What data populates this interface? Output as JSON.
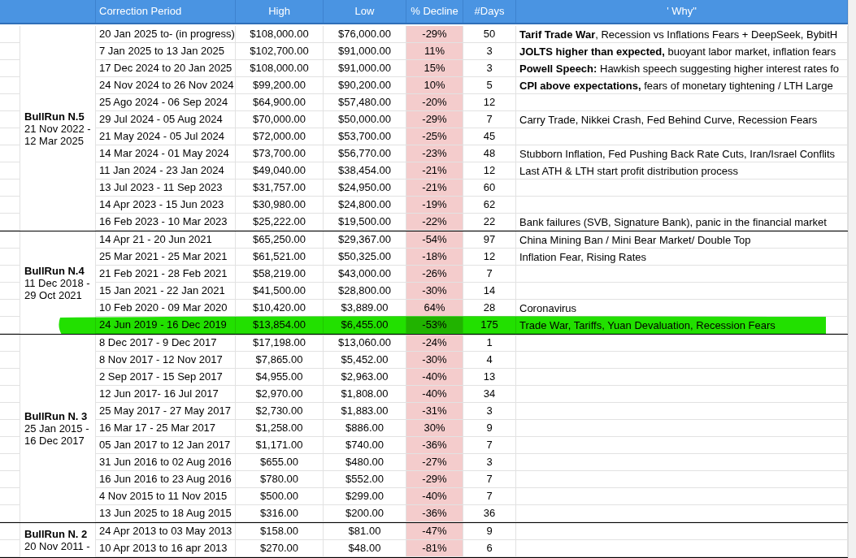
{
  "columns": [
    "Correction Period",
    "High",
    "Low",
    "% Decline",
    "#Days",
    "' Why\""
  ],
  "groups": [
    {
      "name": "BullRun N.5",
      "dates": [
        "21 Nov 2022 -",
        "12 Mar 2025"
      ],
      "rows": [
        {
          "period": "20 Jan 2025 to- (in progress)",
          "high": "$108,000.00",
          "low": "$76,000.00",
          "decline": "-29%",
          "days": "50",
          "why": "**Tarif Trade War**, Recession vs Inflations Fears + DeepSeek, BybitH",
          "highlighted": false
        },
        {
          "period": "7 Jan 2025 to 13 Jan 2025",
          "high": "$102,700.00",
          "low": "$91,000.00",
          "decline": "11%",
          "days": "3",
          "why": "**JOLTS higher than expected,** buoyant labor market, inflation fears",
          "highlighted": false
        },
        {
          "period": "17 Dec 2024 to 20 Jan 2025",
          "high": "$108,000.00",
          "low": "$91,000.00",
          "decline": "15%",
          "days": "3",
          "why": "**Powell Speech:** Hawkish speech suggesting higher interest rates fo",
          "highlighted": false
        },
        {
          "period": "24 Nov 2024 to 26 Nov 2024",
          "high": "$99,200.00",
          "low": "$90,200.00",
          "decline": "10%",
          "days": "5",
          "why": "**CPI above expectations,** fears of monetary tightening / LTH Large",
          "highlighted": false
        },
        {
          "period": "25 Ago 2024 - 06 Sep 2024",
          "high": "$64,900.00",
          "low": "$57,480.00",
          "decline": "-20%",
          "days": "12",
          "highlighted": false
        },
        {
          "period": "29 Jul 2024 - 05 Aug 2024",
          "high": "$70,000.00",
          "low": "$50,000.00",
          "decline": "-29%",
          "days": "7",
          "why": "Carry Trade, Nikkei Crash, Fed Behind Curve, Recession Fears",
          "highlighted": false
        },
        {
          "period": "21 May 2024 - 05 Jul 2024",
          "high": "$72,000.00",
          "low": "$53,700.00",
          "decline": "-25%",
          "days": "45",
          "highlighted": false
        },
        {
          "period": "14 Mar 2024 - 01 May 2024",
          "high": "$73,700.00",
          "low": "$56,770.00",
          "decline": "-23%",
          "days": "48",
          "why": "Stubborn Inflation, Fed Pushing Back Rate Cuts, Iran/Israel Conflits",
          "highlighted": false
        },
        {
          "period": "11 Jan 2024 - 23 Jan 2024",
          "high": "$49,040.00",
          "low": "$38,454.00",
          "decline": "-21%",
          "days": "12",
          "why": "Last ATH & LTH start profit distribution process",
          "highlighted": false
        },
        {
          "period": "13 Jul 2023 - 11 Sep 2023",
          "high": "$31,757.00",
          "low": "$24,950.00",
          "decline": "-21%",
          "days": "60",
          "highlighted": false
        },
        {
          "period": "14 Apr 2023 - 15 Jun 2023",
          "high": "$30,980.00",
          "low": "$24,800.00",
          "decline": "-19%",
          "days": "62",
          "highlighted": false
        },
        {
          "period": "16 Feb 2023 - 10 Mar 2023",
          "high": "$25,222.00",
          "low": "$19,500.00",
          "decline": "-22%",
          "days": "22",
          "why": "Bank failures (SVB, Signature Bank), panic in the financial market",
          "highlighted": false
        }
      ]
    },
    {
      "name": "BullRun N.4",
      "dates": [
        "11 Dec 2018 -",
        "29 Oct 2021"
      ],
      "rows": [
        {
          "period": "14 Apr 21 - 20 Jun 2021",
          "high": "$65,250.00",
          "low": "$29,367.00",
          "decline": "-54%",
          "days": "97",
          "why": "China Mining Ban / Mini Bear Market/ Double Top",
          "highlighted": false
        },
        {
          "period": "25 Mar 2021 - 25 Mar 2021",
          "high": "$61,521.00",
          "low": "$50,325.00",
          "decline": "-18%",
          "days": "12",
          "why": "Inflation Fear, Rising Rates",
          "highlighted": false
        },
        {
          "period": "21 Feb 2021 - 28 Feb 2021",
          "high": "$58,219.00",
          "low": "$43,000.00",
          "decline": "-26%",
          "days": "7",
          "highlighted": false
        },
        {
          "period": "15 Jan 2021 - 22 Jan 2021",
          "high": "$41,500.00",
          "low": "$28,800.00",
          "decline": "-30%",
          "days": "14",
          "highlighted": false
        },
        {
          "period": "10 Feb 2020 - 09 Mar 2020",
          "high": "$10,420.00",
          "low": "$3,889.00",
          "decline": "64%",
          "days": "28",
          "why": "Coronavirus",
          "highlighted": false
        },
        {
          "period": "24 Jun 2019 - 16 Dec 2019",
          "high": "$13,854.00",
          "low": "$6,455.00",
          "decline": "-53%",
          "days": "175",
          "why": "Trade War, Tariffs, Yuan Devaluation, Recession Fears",
          "highlighted": true
        }
      ]
    },
    {
      "name": "BullRun N. 3",
      "dates": [
        "25 Jan 2015 -",
        "16 Dec 2017"
      ],
      "rows": [
        {
          "period": "8 Dec 2017 - 9 Dec 2017",
          "high": "$17,198.00",
          "low": "$13,060.00",
          "decline": "-24%",
          "days": "1",
          "highlighted": false
        },
        {
          "period": "8 Nov 2017 - 12 Nov 2017",
          "high": "$7,865.00",
          "low": "$5,452.00",
          "decline": "-30%",
          "days": "4",
          "highlighted": false
        },
        {
          "period": "2 Sep 2017 - 15 Sep 2017",
          "high": "$4,955.00",
          "low": "$2,963.00",
          "decline": "-40%",
          "days": "13",
          "highlighted": false
        },
        {
          "period": "12 Jun 2017- 16 Jul 2017",
          "high": "$2,970.00",
          "low": "$1,808.00",
          "decline": "-40%",
          "days": "34",
          "highlighted": false
        },
        {
          "period": "25 May 2017 - 27 May 2017",
          "high": "$2,730.00",
          "low": "$1,883.00",
          "decline": "-31%",
          "days": "3",
          "highlighted": false
        },
        {
          "period": "16 Mar 17 - 25 Mar 2017",
          "high": "$1,258.00",
          "low": "$886.00",
          "decline": "30%",
          "days": "9",
          "highlighted": false
        },
        {
          "period": "05 Jan 2017 to 12 Jan 2017",
          "high": "$1,171.00",
          "low": "$740.00",
          "decline": "-36%",
          "days": "7",
          "highlighted": false
        },
        {
          "period": "31 Jun 2016 to 02 Aug 2016",
          "high": "$655.00",
          "low": "$480.00",
          "decline": "-27%",
          "days": "3",
          "highlighted": false
        },
        {
          "period": "16 Jun 2016 to 23 Aug 2016",
          "high": "$780.00",
          "low": "$552.00",
          "decline": "-29%",
          "days": "7",
          "highlighted": false
        },
        {
          "period": "4 Nov 2015 to 11 Nov 2015",
          "high": "$500.00",
          "low": "$299.00",
          "decline": "-40%",
          "days": "7",
          "highlighted": false
        },
        {
          "period": "13 Jun 2025 to 18 Aug 2015",
          "high": "$316.00",
          "low": "$200.00",
          "decline": "-36%",
          "days": "36",
          "highlighted": false
        }
      ]
    },
    {
      "name": "BullRun N. 2",
      "dates": [
        "20 Nov 2011 -"
      ],
      "rows": [
        {
          "period": "24 Apr 2013 to 03 May 2013",
          "high": "$158.00",
          "low": "$81.00",
          "decline": "-47%",
          "days": "9",
          "highlighted": false
        },
        {
          "period": "10 Apr 2013 to 16 apr 2013",
          "high": "$270.00",
          "low": "$48.00",
          "decline": "-81%",
          "days": "6",
          "highlighted": false
        }
      ]
    }
  ]
}
